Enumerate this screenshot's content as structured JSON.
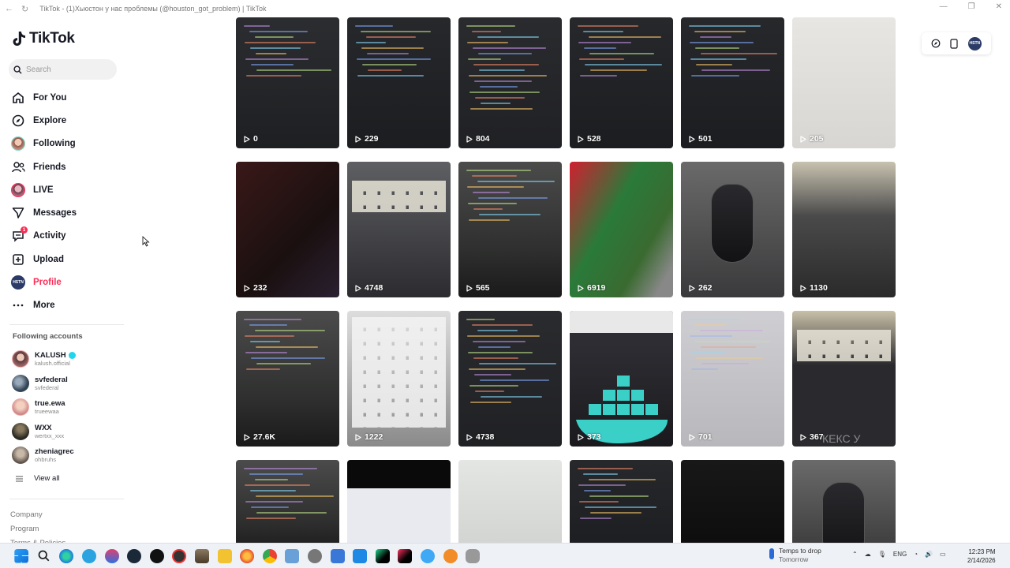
{
  "window": {
    "title": "TikTok - (1)Хьюстон у нас проблемы (@houston_got_problem) | TikTok"
  },
  "app": {
    "name": "TikTok"
  },
  "search": {
    "placeholder": "Search"
  },
  "menu": [
    {
      "label": "For You",
      "icon": "home-icon"
    },
    {
      "label": "Explore",
      "icon": "compass-icon"
    },
    {
      "label": "Following",
      "icon": "following-avatar-icon"
    },
    {
      "label": "Friends",
      "icon": "friends-icon"
    },
    {
      "label": "LIVE",
      "icon": "live-icon"
    },
    {
      "label": "Messages",
      "icon": "messages-icon"
    },
    {
      "label": "Activity",
      "icon": "activity-icon",
      "badge": "1"
    },
    {
      "label": "Upload",
      "icon": "upload-icon"
    },
    {
      "label": "Profile",
      "icon": "profile-avatar-icon",
      "active": true
    },
    {
      "label": "More",
      "icon": "more-icon"
    }
  ],
  "following_accounts": {
    "title": "Following accounts",
    "items": [
      {
        "name": "KALUSH",
        "handle": "kalush.official",
        "verified": true
      },
      {
        "name": "svfederal",
        "handle": "svfederal"
      },
      {
        "name": "true.ewa",
        "handle": "trueewaa"
      },
      {
        "name": "WXX",
        "handle": "wertxx_xxx"
      },
      {
        "name": "zheniagrec",
        "handle": "ohbruhs"
      }
    ],
    "view_all": "View all"
  },
  "footer": [
    "Company",
    "Program",
    "Terms & Policies"
  ],
  "videos": [
    {
      "views": "0",
      "theme": "dark-ui"
    },
    {
      "views": "229",
      "theme": "dark-code"
    },
    {
      "views": "804",
      "theme": "java-code"
    },
    {
      "views": "528",
      "theme": "dark-code"
    },
    {
      "views": "501",
      "theme": "dark-code"
    },
    {
      "views": "205",
      "theme": "paper"
    },
    {
      "views": "232",
      "theme": "dark-red"
    },
    {
      "views": "4748",
      "theme": "keyboard-desk"
    },
    {
      "views": "565",
      "theme": "monitor-code"
    },
    {
      "views": "6919",
      "theme": "laptop-leaf"
    },
    {
      "views": "262",
      "theme": "mouse"
    },
    {
      "views": "1130",
      "theme": "phone-desk"
    },
    {
      "views": "27.6K",
      "theme": "monitor-code"
    },
    {
      "views": "1222",
      "theme": "keyboard-white"
    },
    {
      "views": "4738",
      "theme": "java-code"
    },
    {
      "views": "373",
      "theme": "docker"
    },
    {
      "views": "701",
      "theme": "ide-light"
    },
    {
      "views": "367",
      "theme": "keyboard-dark",
      "overlay": "КЕКС У"
    },
    {
      "views": "",
      "theme": "monitor-code"
    },
    {
      "views": "",
      "theme": "black-web"
    },
    {
      "views": "",
      "theme": "light-gray"
    },
    {
      "views": "",
      "theme": "dark-code"
    },
    {
      "views": "",
      "theme": "black"
    },
    {
      "views": "",
      "theme": "mouse-desk"
    }
  ],
  "topright": {
    "avatar": "HSTN"
  },
  "taskbar": {
    "weather_title": "Temps to drop",
    "weather_sub": "Tomorrow",
    "lang": "ENG",
    "time": "12:23 PM",
    "date": "2/14/2026"
  },
  "colors": {
    "accent": "#fe2c55",
    "text": "#161823"
  }
}
